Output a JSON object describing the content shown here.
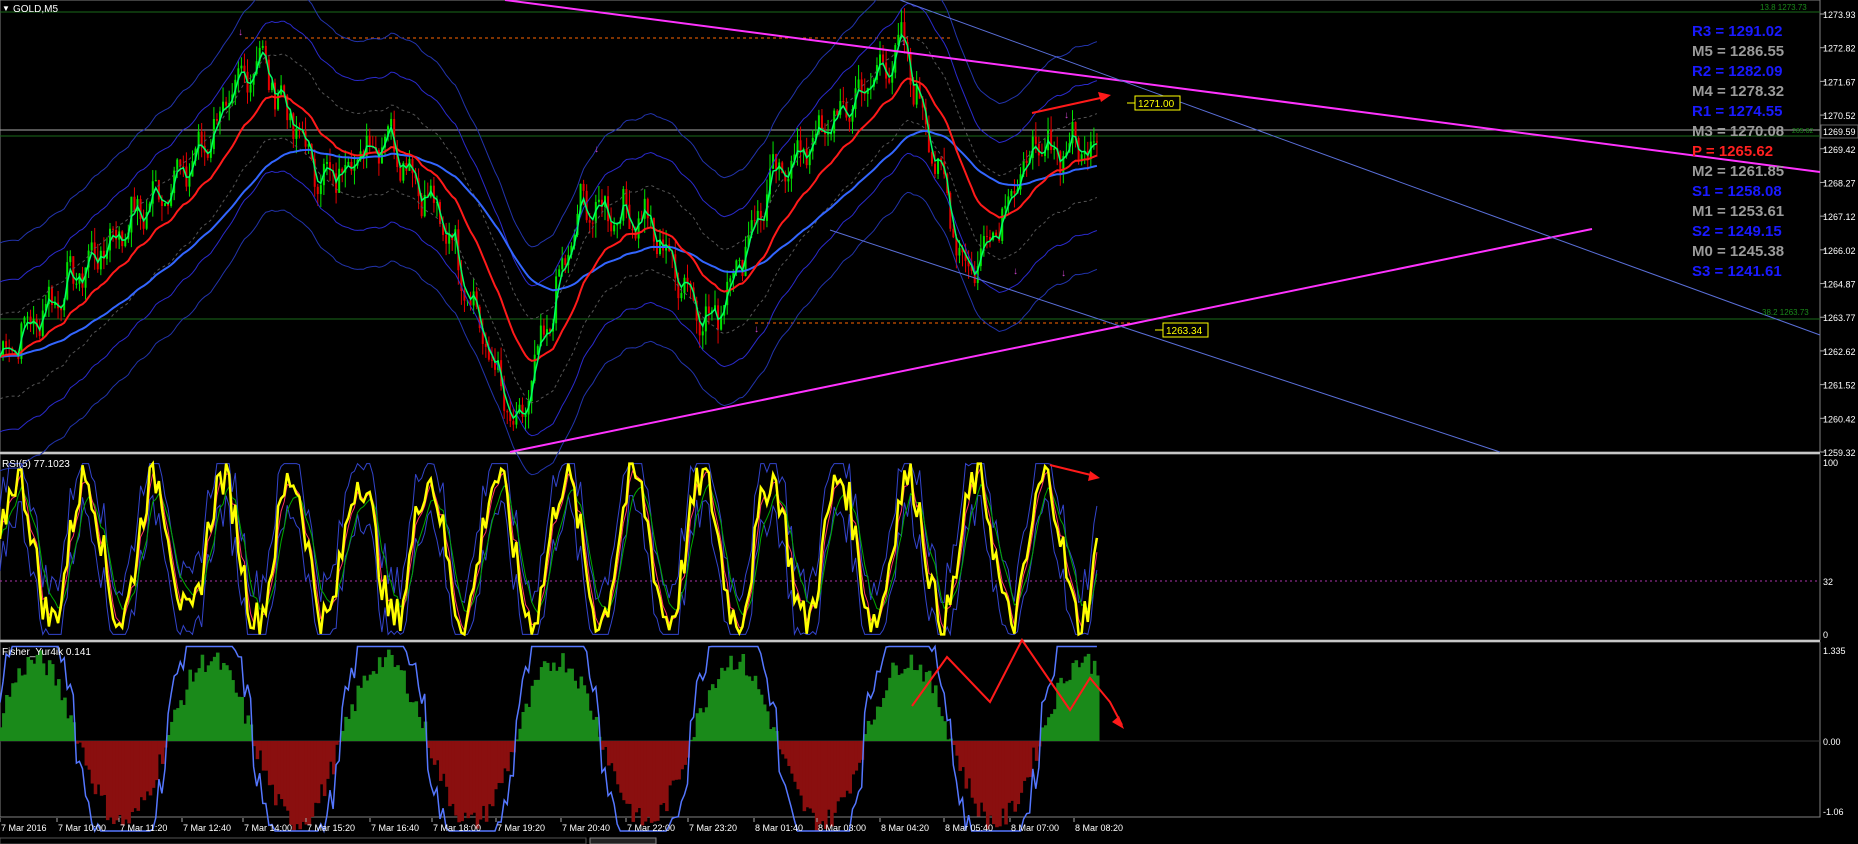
{
  "colors": {
    "bg": "#000000",
    "grid": "#1a1a1a",
    "axis": "#c0c0c0",
    "bull": "#00e600",
    "bear": "#e60000",
    "price_line": "#00ff66",
    "ema_red": "#ff1a1a",
    "ema_blue": "#3366ff",
    "magenta": "#ff33ff",
    "trend_blue": "#5a6fd8",
    "pivot_blue": "#1a1aff",
    "pivot_gray": "#9a9a9a",
    "pivot_red": "#ff2020",
    "rsi_main": "#ffff00",
    "rsi_signal": "#ff3366",
    "rsi_band": "#3344cc",
    "rsi_green": "#00aa00",
    "fisher_pos": "#1a8a1a",
    "fisher_neg": "#8a0f0f",
    "fisher_line": "#5577ff",
    "label_box": "#ffff00"
  },
  "main": {
    "title": "GOLD,M5",
    "price_scale": [
      "1273.93",
      "1272.82",
      "1271.67",
      "1270.52",
      "1269.42",
      "1268.27",
      "1267.12",
      "1266.02",
      "1264.87",
      "1263.77",
      "1262.62",
      "1261.52",
      "1260.42",
      "1259.32"
    ],
    "current_price": "1269.59",
    "fib_top_label": "13.8 1273.73",
    "fib_mid_label": "38.2 1263.73",
    "fib_near_label": "265.62",
    "resistance_label": "1271.00",
    "support_label": "1263.34",
    "pivots": [
      {
        "label": "R3 = 1291.02",
        "color": "pivot_blue"
      },
      {
        "label": "M5 = 1286.55",
        "color": "pivot_gray"
      },
      {
        "label": "R2 = 1282.09",
        "color": "pivot_blue"
      },
      {
        "label": "M4 = 1278.32",
        "color": "pivot_gray"
      },
      {
        "label": "R1 = 1274.55",
        "color": "pivot_blue"
      },
      {
        "label": "M3 = 1270.08",
        "color": "pivot_gray"
      },
      {
        "label": "P   = 1265.62",
        "color": "pivot_red"
      },
      {
        "label": "M2 = 1261.85",
        "color": "pivot_gray"
      },
      {
        "label": "S1 = 1258.08",
        "color": "pivot_blue"
      },
      {
        "label": "M1 = 1253.61",
        "color": "pivot_gray"
      },
      {
        "label": "S2 = 1249.15",
        "color": "pivot_blue"
      },
      {
        "label": "M0 = 1245.38",
        "color": "pivot_gray"
      },
      {
        "label": "S3 = 1241.61",
        "color": "pivot_blue"
      }
    ]
  },
  "rsi": {
    "title": "RSI(5) 77.1023",
    "scale": [
      "100",
      "32",
      "0"
    ]
  },
  "fisher": {
    "title": "Fisher_Yur4ik 0.141",
    "scale": [
      "1.335",
      "0.00",
      "-1.06"
    ]
  },
  "time_axis": [
    "7 Mar 2016",
    "7 Mar 10:00",
    "7 Mar 11:20",
    "7 Mar 12:40",
    "7 Mar 14:00",
    "7 Mar 15:20",
    "7 Mar 16:40",
    "7 Mar 18:00",
    "7 Mar 19:20",
    "7 Mar 20:40",
    "7 Mar 22:00",
    "7 Mar 23:20",
    "8 Mar 01:40",
    "8 Mar 03:00",
    "8 Mar 04:20",
    "8 Mar 05:40",
    "8 Mar 07:00",
    "8 Mar 08:20"
  ],
  "chart_data": {
    "type": "line",
    "title": "GOLD,M5",
    "x": [
      "7 Mar 2016",
      "7 Mar 10:00",
      "7 Mar 11:20",
      "7 Mar 12:40",
      "7 Mar 14:00",
      "7 Mar 15:20",
      "7 Mar 16:40",
      "7 Mar 18:00",
      "7 Mar 19:20",
      "7 Mar 20:40",
      "7 Mar 22:00",
      "7 Mar 23:20",
      "8 Mar 01:40",
      "8 Mar 03:00",
      "8 Mar 04:20",
      "8 Mar 05:40",
      "8 Mar 07:00",
      "8 Mar 08:20"
    ],
    "series": [
      {
        "values": [
          1262.5,
          1264.8,
          1267.0,
          1269.0,
          1272.6,
          1268.3,
          1270.0,
          1266.4,
          1259.8,
          1267.5,
          1267.1,
          1263.5,
          1268.5,
          1270.5,
          1272.9,
          1265.2,
          1269.3,
          1269.59
        ]
      }
    ],
    "ylim": [
      1259.32,
      1273.93
    ]
  }
}
